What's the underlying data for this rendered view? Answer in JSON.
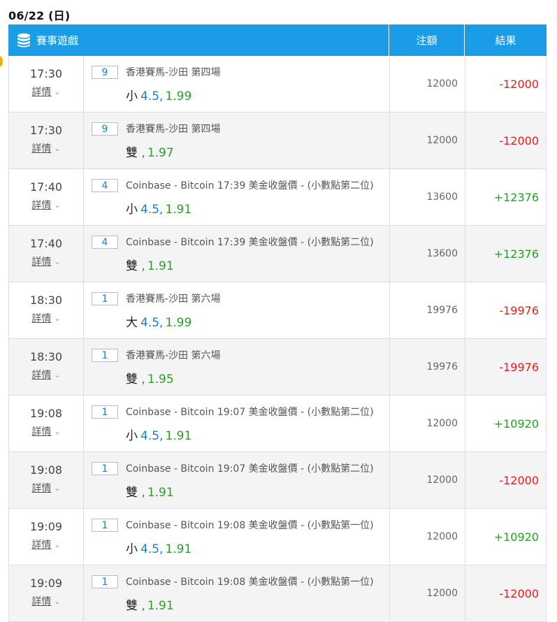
{
  "date_heading": "06/22 (日)",
  "header": {
    "event_label": "賽事遊戲",
    "stake_label": "注額",
    "result_label": "結果",
    "icon": "database-icon"
  },
  "colors": {
    "header_bg": "#1a9ce6",
    "loss": "#e02020",
    "win": "#24a024",
    "line_value": "#1a7fc4",
    "odds": "#2aa02a"
  },
  "rows": [
    {
      "time": "17:30",
      "detail": "詳情",
      "no": "9",
      "event": "香港賽馬-沙田 第四場",
      "pick": "小",
      "line": "4.5",
      "odds": "1.99",
      "stake": "12000",
      "result": "-12000",
      "outcome": "loss"
    },
    {
      "time": "17:30",
      "detail": "詳情",
      "no": "9",
      "event": "香港賽馬-沙田 第四場",
      "pick": "雙",
      "line": "",
      "odds": "1.97",
      "stake": "12000",
      "result": "-12000",
      "outcome": "loss"
    },
    {
      "time": "17:40",
      "detail": "詳情",
      "no": "4",
      "event": "Coinbase - Bitcoin 17:39 美金收盤價 - (小數點第二位)",
      "pick": "小",
      "line": "4.5",
      "odds": "1.91",
      "stake": "13600",
      "result": "+12376",
      "outcome": "win"
    },
    {
      "time": "17:40",
      "detail": "詳情",
      "no": "4",
      "event": "Coinbase - Bitcoin 17:39 美金收盤價 - (小數點第二位)",
      "pick": "雙",
      "line": "",
      "odds": "1.91",
      "stake": "13600",
      "result": "+12376",
      "outcome": "win"
    },
    {
      "time": "18:30",
      "detail": "詳情",
      "no": "1",
      "event": "香港賽馬-沙田 第六場",
      "pick": "大",
      "line": "4.5",
      "odds": "1.99",
      "stake": "19976",
      "result": "-19976",
      "outcome": "loss"
    },
    {
      "time": "18:30",
      "detail": "詳情",
      "no": "1",
      "event": "香港賽馬-沙田 第六場",
      "pick": "雙",
      "line": "",
      "odds": "1.95",
      "stake": "19976",
      "result": "-19976",
      "outcome": "loss"
    },
    {
      "time": "19:08",
      "detail": "詳情",
      "no": "1",
      "event": "Coinbase - Bitcoin 19:07 美金收盤價 - (小數點第二位)",
      "pick": "小",
      "line": "4.5",
      "odds": "1.91",
      "stake": "12000",
      "result": "+10920",
      "outcome": "win"
    },
    {
      "time": "19:08",
      "detail": "詳情",
      "no": "1",
      "event": "Coinbase - Bitcoin 19:07 美金收盤價 - (小數點第二位)",
      "pick": "雙",
      "line": "",
      "odds": "1.91",
      "stake": "12000",
      "result": "-12000",
      "outcome": "loss"
    },
    {
      "time": "19:09",
      "detail": "詳情",
      "no": "1",
      "event": "Coinbase - Bitcoin 19:08 美金收盤價 - (小數點第一位)",
      "pick": "小",
      "line": "4.5",
      "odds": "1.91",
      "stake": "12000",
      "result": "+10920",
      "outcome": "win"
    },
    {
      "time": "19:09",
      "detail": "詳情",
      "no": "1",
      "event": "Coinbase - Bitcoin 19:08 美金收盤價 - (小數點第一位)",
      "pick": "雙",
      "line": "",
      "odds": "1.91",
      "stake": "12000",
      "result": "-12000",
      "outcome": "loss"
    }
  ]
}
